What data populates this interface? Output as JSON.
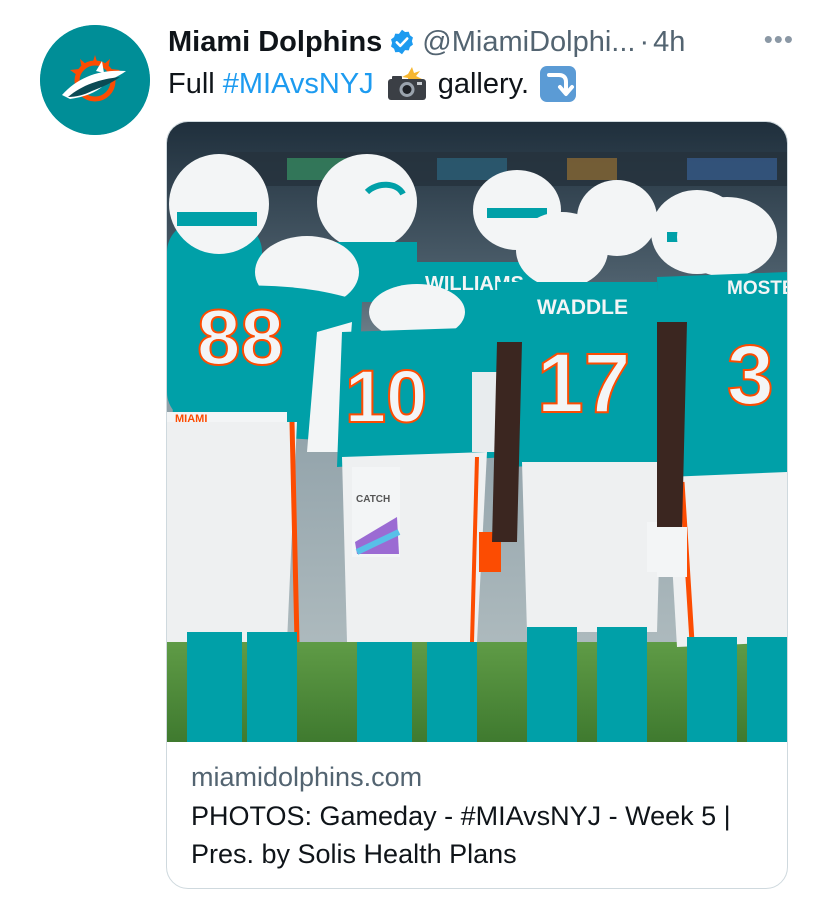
{
  "account": {
    "display_name": "Miami Dolphins",
    "handle": "@MiamiDolphi...",
    "separator": "·",
    "time": "4h",
    "more_label": "•••",
    "avatar_icon": "dolphins-logo-icon",
    "verified_icon": "verified-badge-icon"
  },
  "tweet": {
    "prefix": "Full",
    "hashtag": "#MIAvsNYJ",
    "camera_icon": "camera-with-flash-icon",
    "suffix": "gallery.",
    "arrow_icon": "arrow-curving-down-icon"
  },
  "card": {
    "image_icon": "team-huddle-photo",
    "jerseys": [
      {
        "number": "88",
        "name": ""
      },
      {
        "number": "10",
        "name": ""
      },
      {
        "number": "17",
        "name": "WADDLE"
      },
      {
        "number": "3",
        "name": "MOSTERT"
      },
      {
        "number": "",
        "name": "WILLIAMS"
      }
    ],
    "waist_text": "MIAMI",
    "catch_text": "CATCH",
    "domain": "miamidolphins.com",
    "title": "PHOTOS: Gameday - #MIAvsNYJ - Week 5 | Pres. by Solis Health Plans"
  },
  "colors": {
    "aqua": "#008e97",
    "orange": "#fc4c02",
    "link": "#1d9bf0",
    "secondary_text": "#536471"
  }
}
